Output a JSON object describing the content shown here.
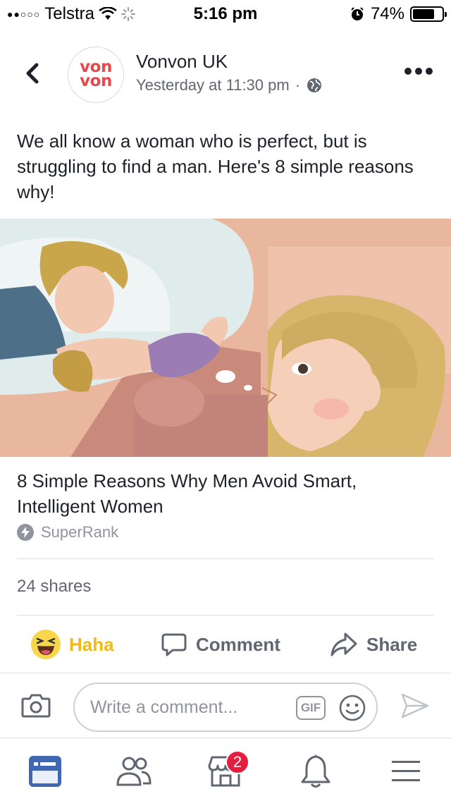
{
  "status_bar": {
    "signal": "●●○○○",
    "carrier": "Telstra",
    "time": "5:16 pm",
    "battery_percent": "74%",
    "battery_level": 0.74
  },
  "header": {
    "page_name": "Vonvon UK",
    "avatar_logo_lines": [
      "von",
      "von"
    ],
    "timestamp": "Yesterday at 11:30 pm",
    "separator": "·",
    "privacy_icon": "globe-icon",
    "more_icon": "more-dots-icon",
    "back_icon": "chevron-left-icon"
  },
  "post": {
    "text": "We all know a woman who is perfect, but is struggling to find a man. Here's 8 simple reasons why!"
  },
  "link_preview": {
    "title": "8 Simple Reasons Why Men Avoid Smart, Intelligent Women",
    "source": "SuperRank",
    "source_icon": "lightning-icon"
  },
  "engagement": {
    "shares": "24 shares"
  },
  "actions": {
    "reaction_label": "Haha",
    "comment_label": "Comment",
    "share_label": "Share"
  },
  "comment_bar": {
    "placeholder": "Write a comment...",
    "gif_label": "GIF"
  },
  "bottom_nav": {
    "items": [
      {
        "name": "news-feed",
        "icon": "news-feed-icon",
        "active": true
      },
      {
        "name": "friends",
        "icon": "friends-icon"
      },
      {
        "name": "marketplace",
        "icon": "marketplace-icon",
        "badge": "2"
      },
      {
        "name": "notifications",
        "icon": "bell-icon"
      },
      {
        "name": "menu",
        "icon": "hamburger-icon"
      }
    ]
  },
  "colors": {
    "accent": "#4267b2",
    "haha": "#f0ba15",
    "badge": "#e41e3f",
    "text_primary": "#1d2129",
    "text_secondary": "#606770",
    "logo_red": "#e8484b"
  }
}
